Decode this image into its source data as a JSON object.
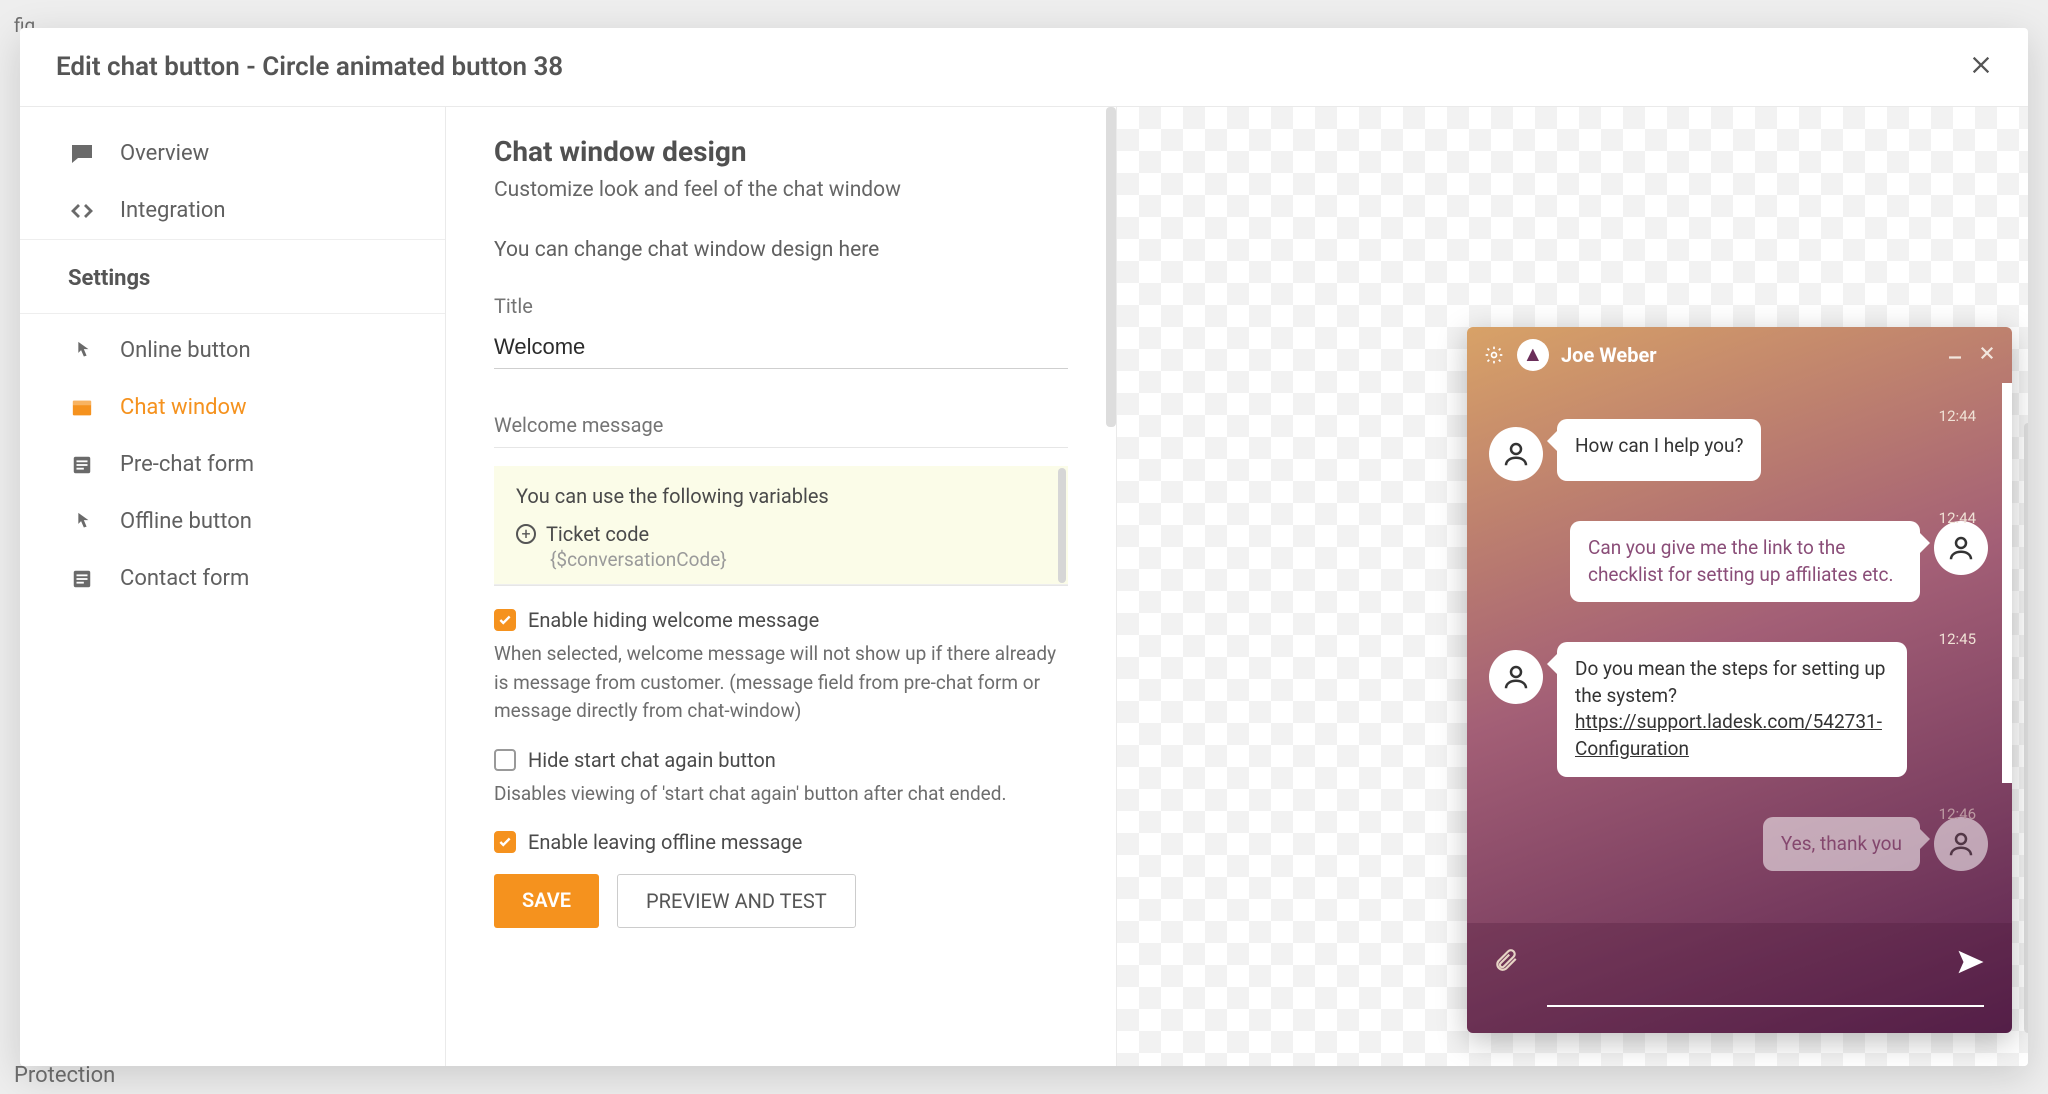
{
  "header": {
    "title": "Edit chat button - Circle animated button 38"
  },
  "background": {
    "top_left_fragment": "fig",
    "bottom_left_fragment": "Protection"
  },
  "sidebar": {
    "items": [
      {
        "label": "Overview",
        "active": false
      },
      {
        "label": "Integration",
        "active": false
      }
    ],
    "section_label": "Settings",
    "settings_items": [
      {
        "label": "Online button",
        "active": false
      },
      {
        "label": "Chat window",
        "active": true
      },
      {
        "label": "Pre-chat form",
        "active": false
      },
      {
        "label": "Offline button",
        "active": false
      },
      {
        "label": "Contact form",
        "active": false
      }
    ]
  },
  "panel": {
    "title": "Chat window design",
    "subtitle": "Customize look and feel of the chat window",
    "description": "You can change chat window design here",
    "title_field_label": "Title",
    "title_field_value": "Welcome",
    "welcome_label": "Welcome message",
    "hint": {
      "title": "You can use the following variables",
      "var_label": "Ticket code",
      "var_code": "{$conversationCode}"
    },
    "opt1": {
      "checked": true,
      "label": "Enable hiding welcome message",
      "help": "When selected, welcome message will not show up if there already is message from customer. (message field from pre-chat form or message directly from chat-window)"
    },
    "opt2": {
      "checked": false,
      "label": "Hide start chat again button",
      "help": "Disables viewing of 'start chat again' button after chat ended."
    },
    "opt3": {
      "checked": true,
      "label": "Enable leaving offline message"
    },
    "save_label": "SAVE",
    "preview_label": "PREVIEW AND TEST"
  },
  "chat": {
    "agent_name": "Joe Weber",
    "messages": [
      {
        "dir": "in",
        "time": "12:44",
        "text": "How can I help you?"
      },
      {
        "dir": "out",
        "time": "12:44",
        "text": "Can you give me the link to the checklist for setting up affiliates etc."
      },
      {
        "dir": "in",
        "time": "12:45",
        "text": "Do you mean the steps for setting up the system?",
        "link": "https://support.ladesk.com/542731-Configuration"
      },
      {
        "dir": "out",
        "time": "12:46",
        "text": "Yes, thank you"
      }
    ]
  }
}
